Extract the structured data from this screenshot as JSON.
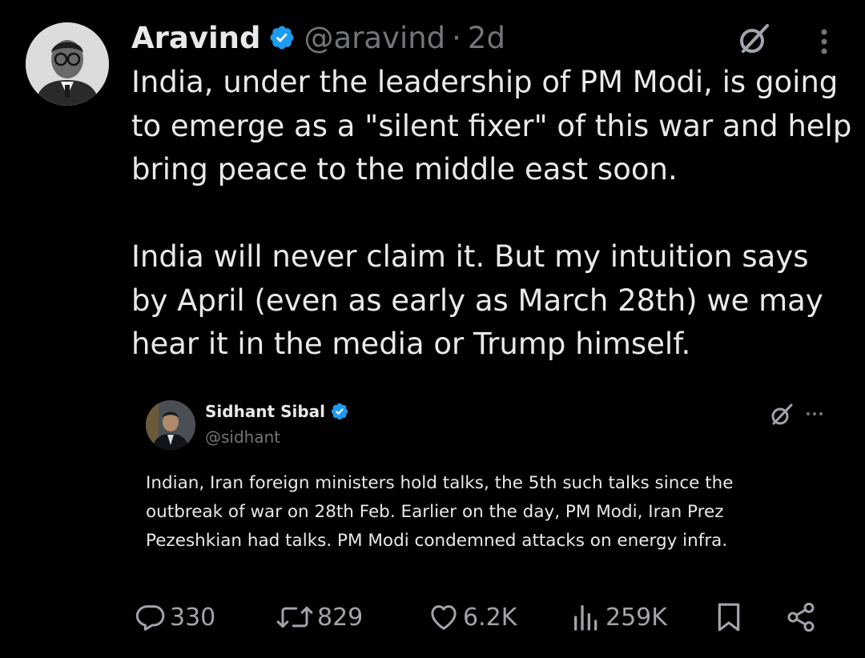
{
  "tweet": {
    "author_name": "Aravind",
    "handle": "@aravind",
    "separator": "·",
    "time": "2d",
    "paragraphs": [
      "India, under the leadership of PM Modi, is going to emerge as a \"silent fixer\" of this war and help bring peace to the middle east soon.",
      "India will never claim it. But my intuition says by April (even as early as March 28th) we may hear it in the media or Trump himself."
    ]
  },
  "quote": {
    "author_name": "Sidhant Sibal",
    "handle": "@sidhant",
    "text": "Indian, Iran foreign ministers hold talks, the 5th such talks since the outbreak of war on 28th Feb. Earlier on the day, PM Modi, Iran Prez Pezeshkian had talks. PM Modi condemned attacks on energy infra."
  },
  "actions": {
    "replies": "330",
    "reposts": "829",
    "likes": "6.2K",
    "views": "259K"
  },
  "icons": {
    "verified": "verified-badge-icon",
    "grok": "grok-icon",
    "more": "more-options-icon",
    "reply": "reply-bubble-icon",
    "repost": "repost-arrows-icon",
    "like": "heart-icon",
    "views": "analytics-bars-icon",
    "bookmark": "bookmark-icon",
    "share": "share-icon"
  },
  "colors": {
    "background": "#000000",
    "text_primary": "#e7e9ea",
    "text_secondary": "#71767b",
    "verified_blue": "#1d9bf0"
  }
}
